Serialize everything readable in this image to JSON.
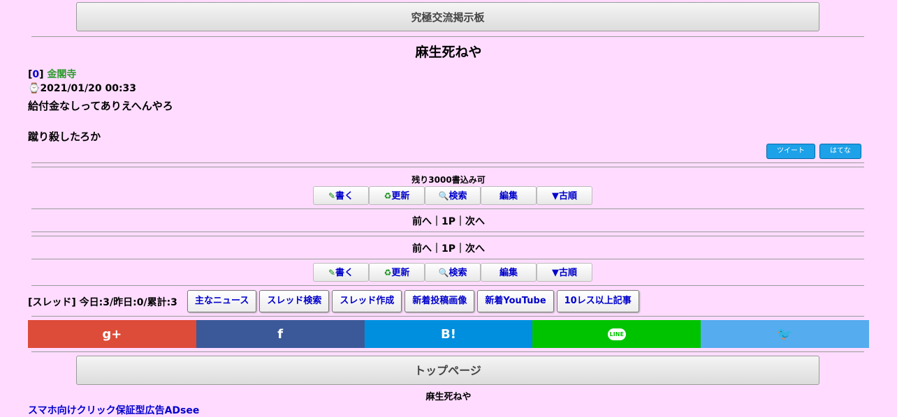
{
  "header": {
    "board_button": "究極交流掲示板"
  },
  "thread": {
    "title": "麻生死ねや"
  },
  "post": {
    "number": "0",
    "author": "金閣寺",
    "datetime": "2021/01/20 00:33",
    "line1": "給付金なしってありえへんやろ",
    "line2": "蹴り殺したろか"
  },
  "share_small": {
    "tweet": "ツイート",
    "hatena": "はてな"
  },
  "remaining": "残り3000書込み可",
  "toolbar": {
    "write": "書く",
    "refresh": "更新",
    "search": "検索",
    "edit": "編集",
    "order": "▼古順"
  },
  "pager": {
    "prev": "前へ",
    "page": "1P",
    "next": "次へ",
    "sep": "｜"
  },
  "stats": {
    "text": "[スレッド] 今日:3/昨日:0/累計:3"
  },
  "links": [
    "主なニュース",
    "スレッド検索",
    "スレッド作成",
    "新着投稿画像",
    "新着YouTube",
    "10レス以上記事"
  ],
  "share_bar": {
    "gplus": "g+",
    "facebook": "f",
    "hatena": "B!",
    "line": "LINE",
    "twitter": "🐦",
    "colors": {
      "gplus": "#dd4b39",
      "facebook": "#3b5998",
      "hatena": "#008fde",
      "line": "#00c300",
      "twitter": "#55acee"
    }
  },
  "footer": {
    "top_button": "トップページ",
    "thread_title": "麻生死ねや",
    "ad_link": "スマホ向けクリック保証型広告ADsee"
  }
}
